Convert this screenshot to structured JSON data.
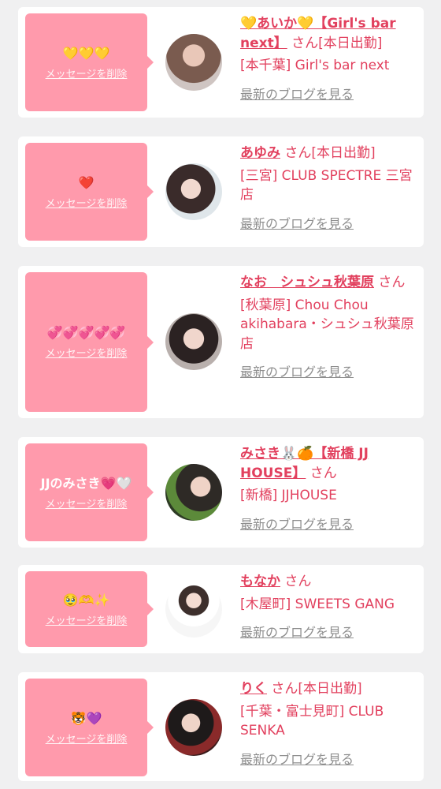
{
  "delete_label": "メッセージを削除",
  "blog_label": "最新のブログを見る",
  "san_suffix": "さん",
  "colors": {
    "card_bg": "#ffffff",
    "bubble": "#ff9aac",
    "accent": "#e2405e",
    "page_bg": "#f0f0f1",
    "blog_link": "#8e8e8e"
  },
  "items": [
    {
      "message": "💛💛💛",
      "name": "💛あいか💛【Girl's bar next】",
      "status": "[本日出勤]",
      "shop": "[本千葉] Girl's bar next",
      "avatar_icon": "avatar-photo"
    },
    {
      "message": "❤️",
      "name": "あゆみ",
      "status": "[本日出勤]",
      "shop": "[三宮] CLUB SPECTRE 三宮店",
      "avatar_icon": "avatar-photo"
    },
    {
      "message": "💞💞💞💞💞",
      "name": "なお　シュシュ秋葉原",
      "status": "",
      "shop": "[秋葉原] Chou Chou akihabara・シュシュ秋葉原店",
      "avatar_icon": "avatar-photo"
    },
    {
      "message": "JJのみさき💗🤍",
      "name": "みさき🐰🍊【新橋 JJ HOUSE】",
      "status": "",
      "shop": "[新橋] JJHOUSE",
      "avatar_icon": "avatar-photo"
    },
    {
      "message": "🥹🫶✨",
      "name": "もなか",
      "status": "",
      "shop": "[木屋町] SWEETS GANG",
      "avatar_icon": "avatar-photo"
    },
    {
      "message": "🐯💜",
      "name": "りく",
      "status": "[本日出勤]",
      "shop": "[千葉・富士見町] CLUB SENKA",
      "avatar_icon": "avatar-photo"
    }
  ]
}
